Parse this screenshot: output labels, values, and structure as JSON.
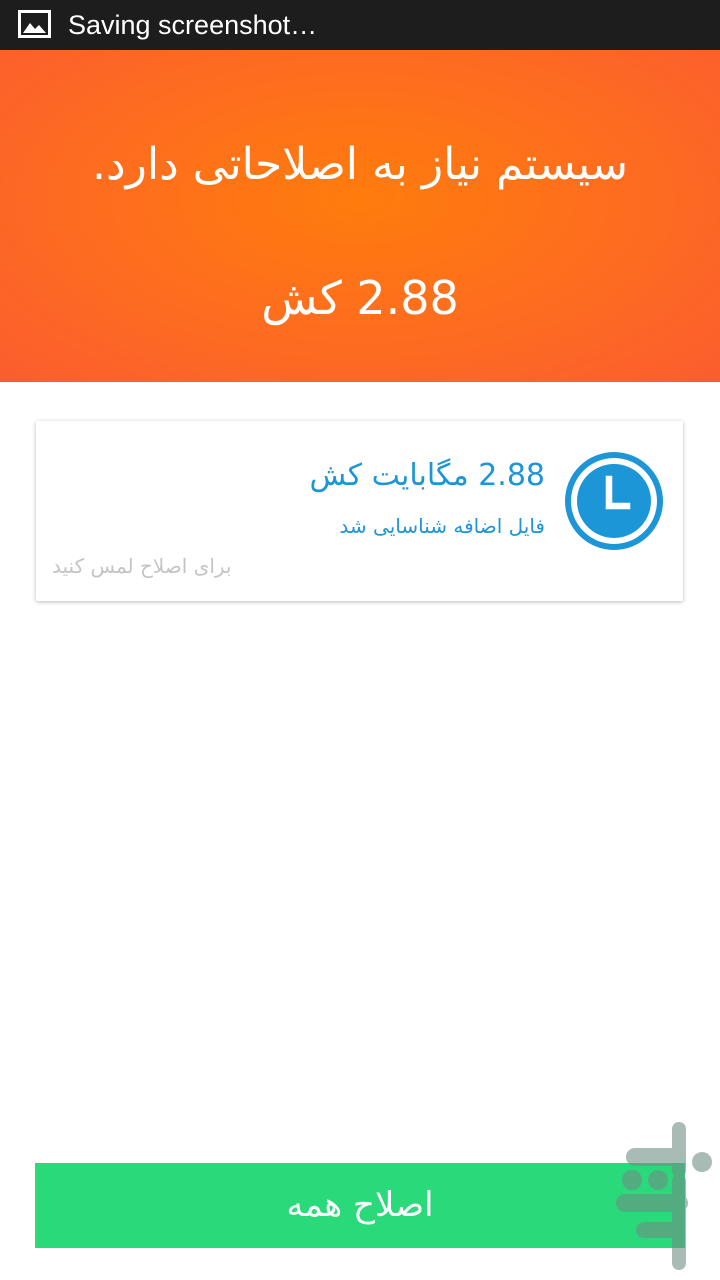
{
  "status_bar": {
    "text": "Saving screenshot…",
    "icon": "image-icon"
  },
  "hero": {
    "headline": "سیستم نیاز به اصلاحاتی دارد.",
    "size": "2.88 کش"
  },
  "card": {
    "icon": "clock-icon",
    "title": "2.88 مگابایت کش",
    "subtitle": "فایل اضافه شناسایی شد",
    "hint": "برای اصلاح لمس کنید"
  },
  "actions": {
    "fix_all_label": "اصلاح همه"
  },
  "colors": {
    "status_bar": "#1d1d1d",
    "hero": "#fd6a22",
    "accent_blue": "#1d96d8",
    "hint_gray": "#c4c4c4",
    "button_green": "#2ad97a"
  },
  "watermark": {
    "icon": "cafebazaar-logo-icon"
  }
}
